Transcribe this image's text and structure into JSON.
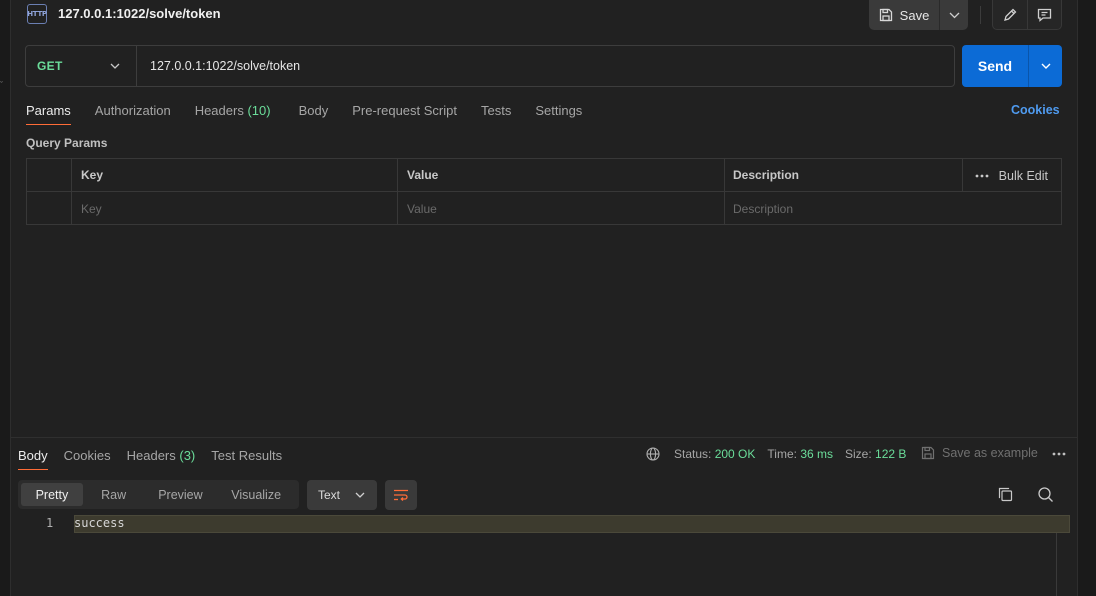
{
  "request": {
    "title": "127.0.0.1:1022/solve/token",
    "method": "GET",
    "url": "127.0.0.1:1022/solve/token"
  },
  "toolbar": {
    "save_label": "Save",
    "send_label": "Send"
  },
  "request_tabs": [
    {
      "label": "Params",
      "active": true
    },
    {
      "label": "Authorization"
    },
    {
      "label": "Headers",
      "count": "(10)"
    },
    {
      "label": "Body"
    },
    {
      "label": "Pre-request Script"
    },
    {
      "label": "Tests"
    },
    {
      "label": "Settings"
    }
  ],
  "cookies_label": "Cookies",
  "query_params": {
    "title": "Query Params",
    "headers": {
      "key": "Key",
      "value": "Value",
      "description": "Description"
    },
    "bulk_edit": "Bulk Edit",
    "placeholders": {
      "key": "Key",
      "value": "Value",
      "description": "Description"
    }
  },
  "response_tabs": [
    {
      "label": "Body",
      "active": true
    },
    {
      "label": "Cookies"
    },
    {
      "label": "Headers",
      "count": "(3)"
    },
    {
      "label": "Test Results"
    }
  ],
  "response_meta": {
    "status_label": "Status:",
    "status_value": "200 OK",
    "time_label": "Time:",
    "time_value": "36 ms",
    "size_label": "Size:",
    "size_value": "122 B",
    "save_example": "Save as example"
  },
  "view_modes": [
    "Pretty",
    "Raw",
    "Preview",
    "Visualize"
  ],
  "format": "Text",
  "response_body": {
    "line_number": "1",
    "text": "success"
  },
  "colors": {
    "accent_orange": "#ff6c37",
    "send_blue": "#0c6bd6",
    "method_green": "#6bdd9a",
    "link_blue": "#4f9bf0"
  }
}
